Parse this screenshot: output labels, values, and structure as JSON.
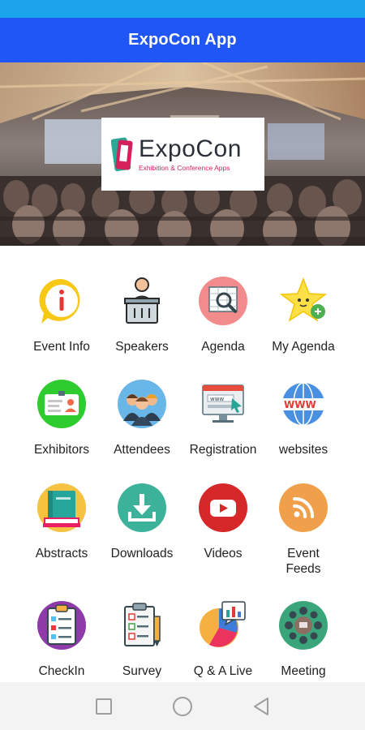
{
  "app": {
    "title": "ExpoCon App"
  },
  "banner": {
    "logo_name": "ExpoCon",
    "logo_tagline": "Exhibition & Conference Apps"
  },
  "menu": [
    {
      "label": "Event Info",
      "icon": "info-icon"
    },
    {
      "label": "Speakers",
      "icon": "speaker-podium-icon"
    },
    {
      "label": "Agenda",
      "icon": "agenda-icon"
    },
    {
      "label": "My Agenda",
      "icon": "star-add-icon"
    },
    {
      "label": "Exhibitors",
      "icon": "id-card-icon"
    },
    {
      "label": "Attendees",
      "icon": "people-icon"
    },
    {
      "label": "Registration",
      "icon": "web-form-icon"
    },
    {
      "label": "websites",
      "icon": "globe-www-icon"
    },
    {
      "label": "Abstracts",
      "icon": "books-icon"
    },
    {
      "label": "Downloads",
      "icon": "download-icon"
    },
    {
      "label": "Videos",
      "icon": "video-play-icon"
    },
    {
      "label": "Event\nFeeds",
      "icon": "rss-icon"
    },
    {
      "label": "CheckIn",
      "icon": "checklist-icon"
    },
    {
      "label": "Survey",
      "icon": "survey-icon"
    },
    {
      "label": "Q & A Live",
      "icon": "chart-chat-icon"
    },
    {
      "label": "Meeting",
      "icon": "meeting-table-icon"
    }
  ],
  "colors": {
    "status_bar": "#1ba3ec",
    "app_bar": "#1f56f5"
  },
  "nav": {
    "recent": "square-icon",
    "home": "circle-icon",
    "back": "triangle-back-icon"
  }
}
